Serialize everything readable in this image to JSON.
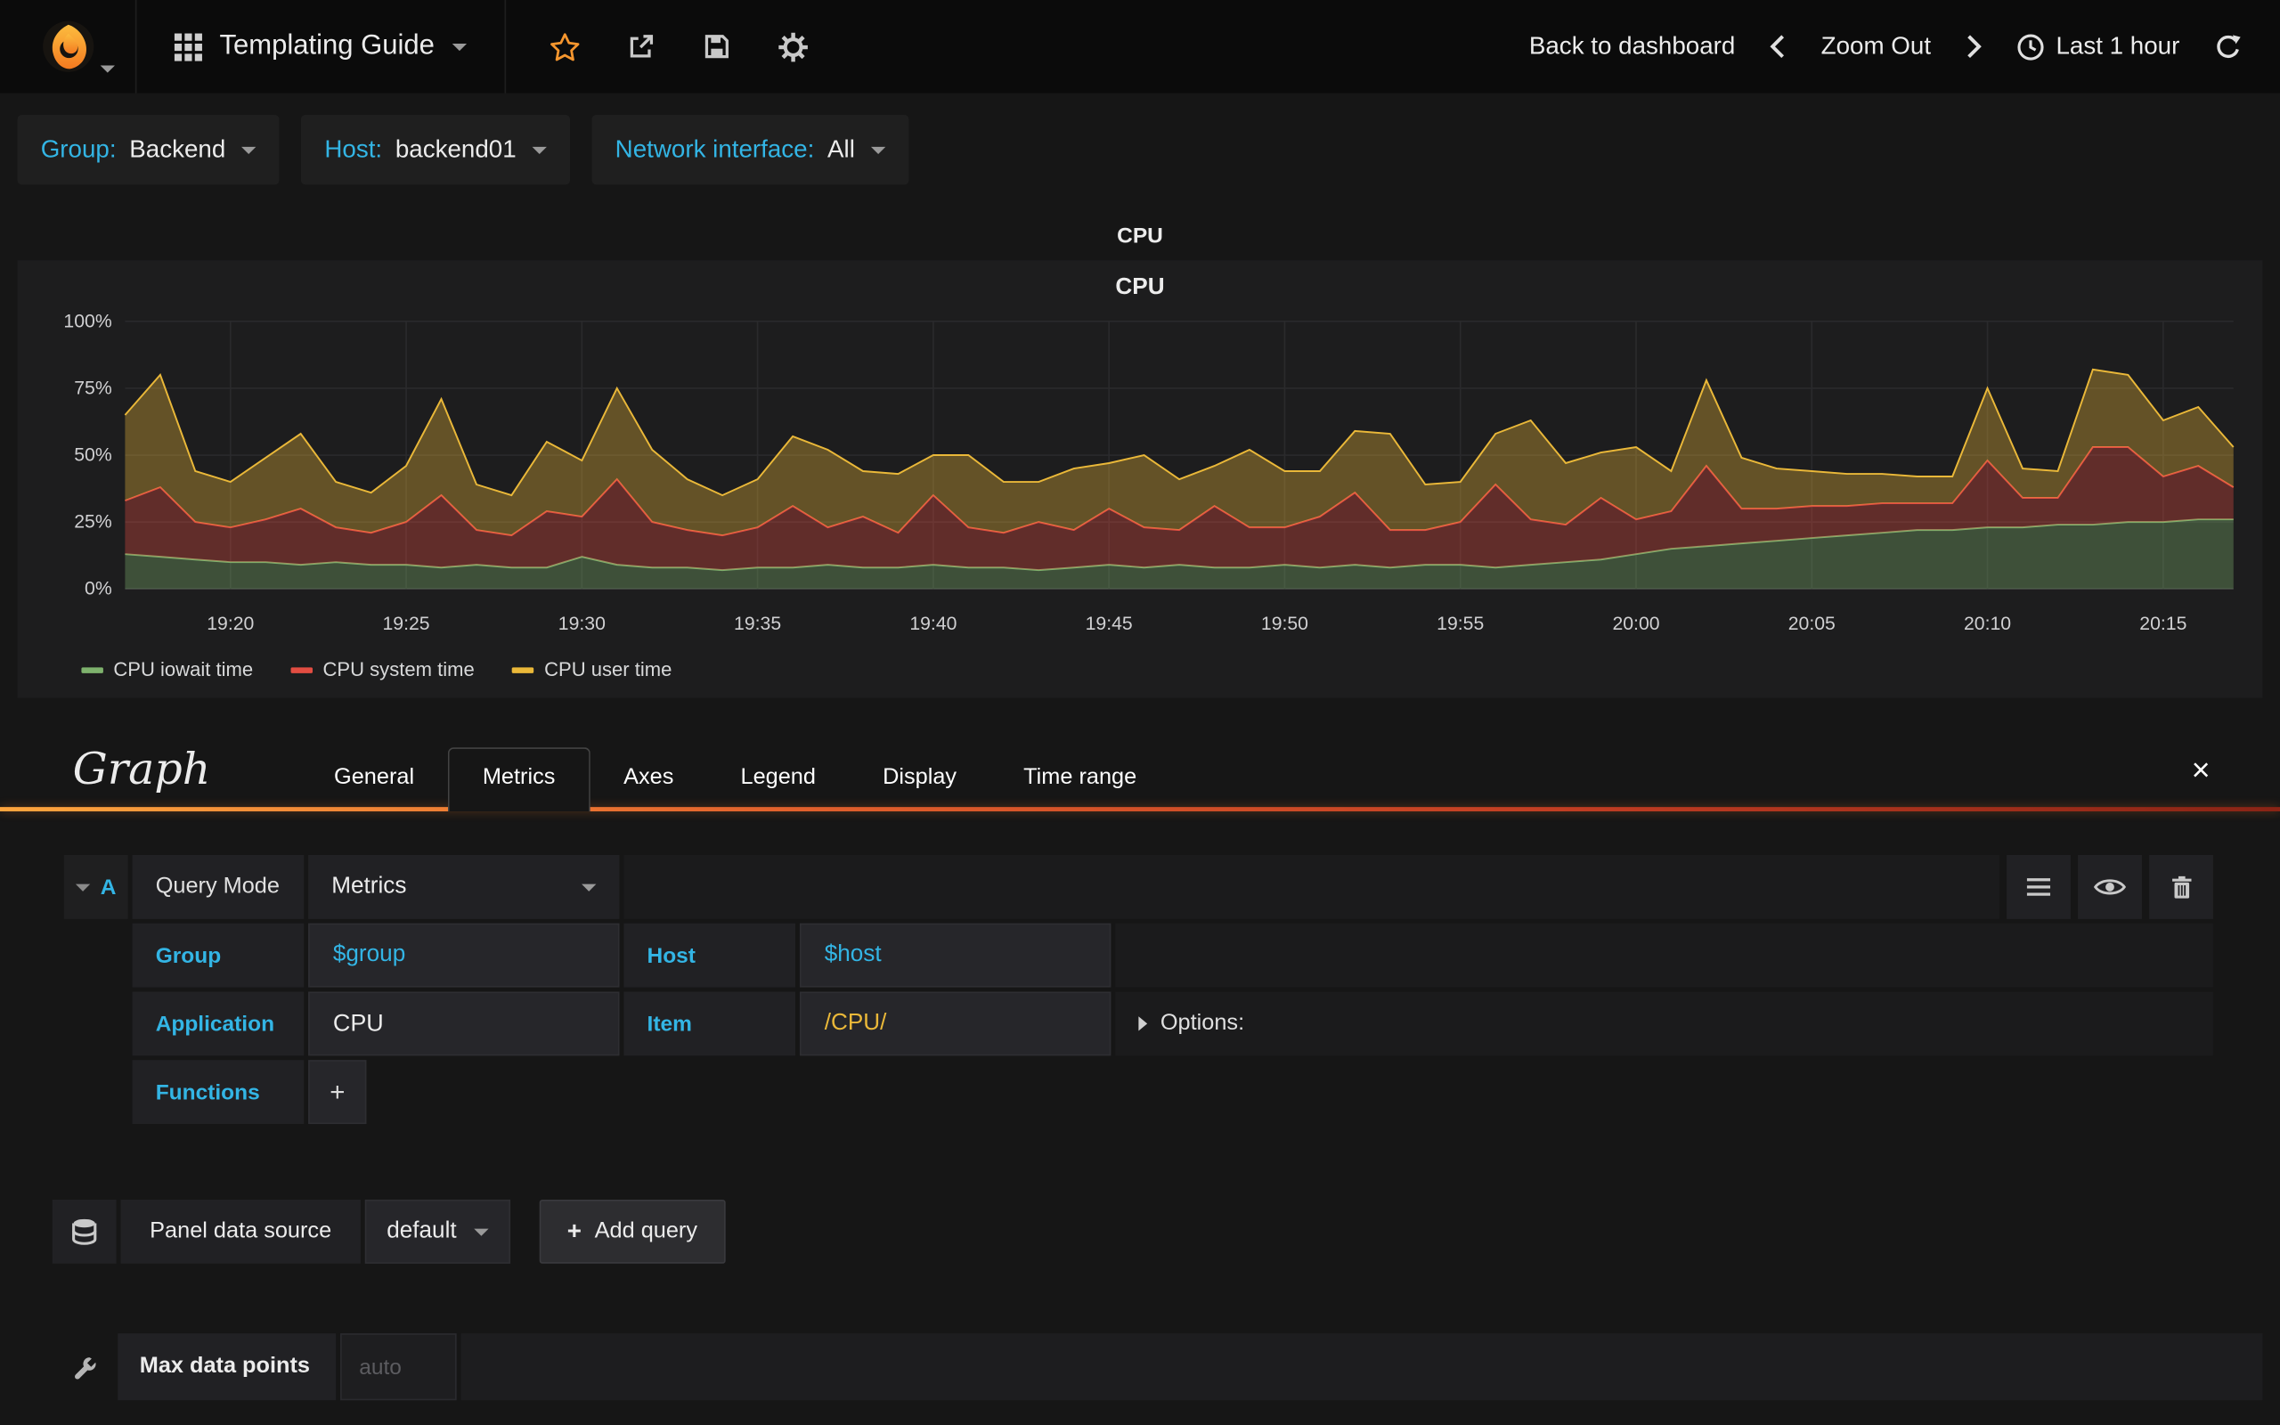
{
  "navbar": {
    "title": "Templating Guide",
    "back_to_dashboard": "Back to dashboard",
    "zoom_out": "Zoom Out",
    "time_range": "Last 1 hour"
  },
  "icons": {
    "grafana-logo": "orange flame in dark circle",
    "dashboard-grid-icon": "3x3 squares",
    "star-icon": "☆ outline, orange #f6962e",
    "share-icon": "arrow out of box",
    "save-icon": "floppy disk",
    "gear-icon": "cogwheel",
    "chevron-left-icon": "❮",
    "chevron-right-icon": "❯",
    "clock-icon": "clock face",
    "refresh-icon": "circular arrow",
    "close-icon": "×",
    "menu-icon": "hamburger ≡",
    "eye-icon": "eye",
    "trash-icon": "trash can",
    "database-icon": "cylinder",
    "wrench-icon": "wrench",
    "plus-icon": "+"
  },
  "colors": {
    "accent_cyan": "#33b5e5",
    "accent_yellow": "#EAB839",
    "star_orange": "#f6962e",
    "gradient_left": "#ffa53e",
    "gradient_right": "#8a2415"
  },
  "variables": [
    {
      "label": "Group:",
      "value": "Backend"
    },
    {
      "label": "Host:",
      "value": "backend01"
    },
    {
      "label": "Network interface:",
      "value": "All"
    }
  ],
  "panel": {
    "title": "CPU"
  },
  "chart_data": {
    "type": "area",
    "stacked": true,
    "title": "CPU",
    "xlabel": "",
    "ylabel": "",
    "ylim": [
      0,
      100
    ],
    "y_ticks": [
      "0%",
      "25%",
      "50%",
      "75%",
      "100%"
    ],
    "grid": true,
    "legend_position": "bottom-left",
    "x_range_minutes": [
      0,
      60
    ],
    "x_start_time": "19:17",
    "x_end_time": "20:17",
    "x_ticks": [
      {
        "t": 3,
        "label": "19:20"
      },
      {
        "t": 8,
        "label": "19:25"
      },
      {
        "t": 13,
        "label": "19:30"
      },
      {
        "t": 18,
        "label": "19:35"
      },
      {
        "t": 23,
        "label": "19:40"
      },
      {
        "t": 28,
        "label": "19:45"
      },
      {
        "t": 33,
        "label": "19:50"
      },
      {
        "t": 38,
        "label": "19:55"
      },
      {
        "t": 43,
        "label": "20:00"
      },
      {
        "t": 48,
        "label": "20:05"
      },
      {
        "t": 53,
        "label": "20:10"
      },
      {
        "t": 58,
        "label": "20:15"
      }
    ],
    "fill_opacity": 0.35,
    "series": [
      {
        "name": "CPU iowait time",
        "color": "#7EB26D",
        "values": [
          13,
          12,
          11,
          10,
          10,
          9,
          10,
          9,
          9,
          8,
          9,
          8,
          8,
          12,
          9,
          8,
          8,
          7,
          8,
          8,
          9,
          8,
          8,
          9,
          8,
          8,
          7,
          8,
          9,
          8,
          9,
          8,
          8,
          9,
          8,
          9,
          8,
          9,
          9,
          8,
          9,
          10,
          11,
          13,
          15,
          16,
          17,
          18,
          19,
          20,
          21,
          22,
          22,
          23,
          23,
          24,
          24,
          25,
          25,
          26,
          26
        ]
      },
      {
        "name": "CPU system time",
        "color": "#E24D42",
        "values": [
          20,
          26,
          14,
          13,
          16,
          21,
          13,
          12,
          16,
          27,
          13,
          12,
          21,
          15,
          32,
          17,
          14,
          13,
          15,
          23,
          14,
          19,
          13,
          26,
          15,
          13,
          18,
          14,
          21,
          15,
          13,
          23,
          15,
          14,
          19,
          27,
          14,
          13,
          16,
          31,
          17,
          14,
          23,
          13,
          14,
          30,
          13,
          12,
          12,
          11,
          11,
          10,
          10,
          25,
          11,
          10,
          29,
          28,
          17,
          20,
          12
        ]
      },
      {
        "name": "CPU user time",
        "color": "#EAB839",
        "values": [
          32,
          42,
          19,
          17,
          23,
          28,
          17,
          15,
          21,
          36,
          17,
          15,
          26,
          21,
          34,
          27,
          19,
          15,
          18,
          26,
          29,
          17,
          22,
          15,
          27,
          19,
          15,
          23,
          17,
          27,
          19,
          15,
          29,
          21,
          17,
          23,
          36,
          17,
          15,
          19,
          37,
          23,
          17,
          27,
          15,
          32,
          19,
          15,
          13,
          12,
          11,
          10,
          10,
          27,
          11,
          10,
          29,
          27,
          21,
          22,
          15
        ]
      }
    ]
  },
  "editor": {
    "panel_type": "Graph",
    "tabs": [
      {
        "label": "General"
      },
      {
        "label": "Metrics",
        "active": true
      },
      {
        "label": "Axes"
      },
      {
        "label": "Legend"
      },
      {
        "label": "Display"
      },
      {
        "label": "Time range"
      }
    ],
    "query": {
      "ref_id": "A",
      "query_mode_label": "Query Mode",
      "query_mode_value": "Metrics",
      "group_label": "Group",
      "group_value": "$group",
      "host_label": "Host",
      "host_value": "$host",
      "application_label": "Application",
      "application_value": "CPU",
      "item_label": "Item",
      "item_value": "/CPU/",
      "options_label": "Options:",
      "functions_label": "Functions",
      "add_function_label": "+"
    },
    "datasource": {
      "label": "Panel data source",
      "value": "default",
      "add_query_label": "Add query"
    },
    "max_data_points": {
      "label": "Max data points",
      "placeholder": "auto"
    }
  }
}
